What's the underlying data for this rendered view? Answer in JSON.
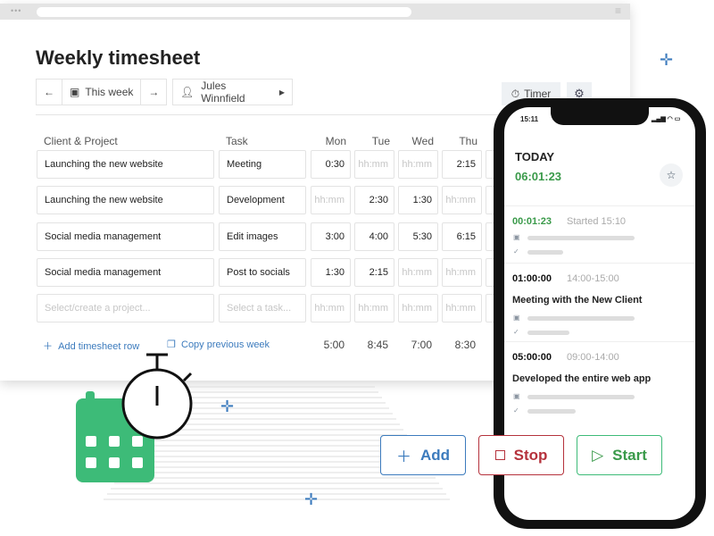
{
  "header": {
    "title": "Weekly timesheet",
    "prev": "←",
    "next": "→",
    "week": "This week",
    "user": "Jules Winnfield",
    "timer": "Timer"
  },
  "columns": [
    "Client & Project",
    "Task",
    "Mon",
    "Tue",
    "Wed",
    "Thu"
  ],
  "rows": [
    {
      "project": "Launching the new website",
      "task": "Meeting",
      "days": [
        "0:30",
        "hh:mm",
        "hh:mm",
        "2:15"
      ]
    },
    {
      "project": "Launching the new website",
      "task": "Development",
      "days": [
        "hh:mm",
        "2:30",
        "1:30",
        "hh:mm"
      ]
    },
    {
      "project": "Social media management",
      "task": "Edit images",
      "days": [
        "3:00",
        "4:00",
        "5:30",
        "6:15"
      ]
    },
    {
      "project": "Social media management",
      "task": "Post to socials",
      "days": [
        "1:30",
        "2:15",
        "hh:mm",
        "hh:mm"
      ]
    },
    {
      "project": "Select/create a project...",
      "task": "Select a task...",
      "days": [
        "hh:mm",
        "hh:mm",
        "hh:mm",
        "hh:mm"
      ]
    }
  ],
  "footer": {
    "add_row": "Add timesheet row",
    "copy": "Copy previous week",
    "totals": [
      "5:00",
      "8:45",
      "7:00",
      "8:30"
    ]
  },
  "phone": {
    "clock": "15:11",
    "today": "TODAY",
    "total": "06:01:23",
    "entries": [
      {
        "duration": "00:01:23",
        "time": "Started 15:10",
        "title": ""
      },
      {
        "duration": "01:00:00",
        "time": "14:00-15:00",
        "title": "Meeting with the New Client"
      },
      {
        "duration": "05:00:00",
        "time": "09:00-14:00",
        "title": "Developed the entire web app"
      }
    ]
  },
  "actions": {
    "add": "Add",
    "stop": "Stop",
    "start": "Start"
  },
  "colors": {
    "green": "#3a9a4a",
    "blue": "#3c7bbd",
    "red": "#b5323c",
    "calendar": "#3dbb78"
  }
}
